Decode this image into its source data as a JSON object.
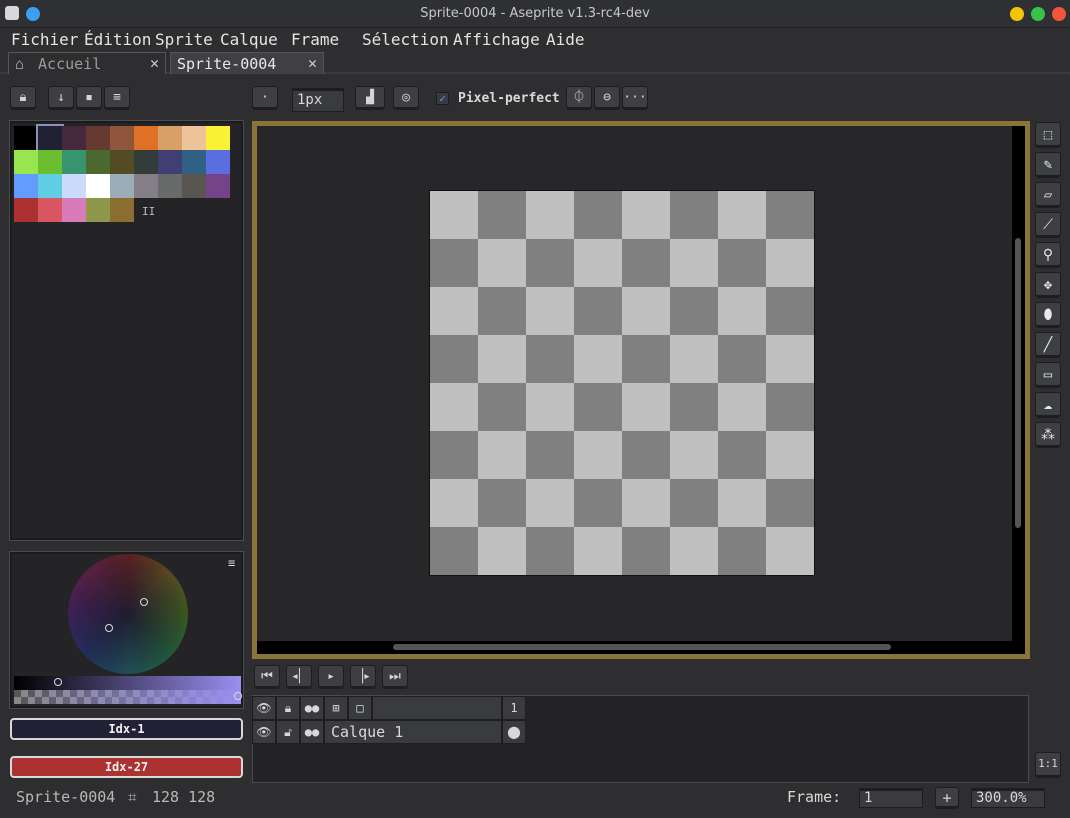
{
  "window": {
    "title": "Sprite-0004 - Aseprite v1.3-rc4-dev"
  },
  "menu": {
    "items": [
      "Fichier",
      "Édition",
      "Sprite",
      "Calque",
      "Frame",
      "Sélection",
      "Affichage",
      "Aide"
    ]
  },
  "tabs": [
    {
      "label": "Accueil"
    },
    {
      "label": "Sprite-0004"
    }
  ],
  "toolbar": {
    "brush_size": "1px",
    "pixel_perfect_label": "Pixel-perfect",
    "pixel_perfect_checked": true,
    "more": "···"
  },
  "palette": {
    "colors": [
      "#000000",
      "#222034",
      "#45283c",
      "#663931",
      "#8f563b",
      "#df7126",
      "#d9a066",
      "#eec39a",
      "#fbf236",
      "#99e550",
      "#6abe30",
      "#37946e",
      "#4b692f",
      "#524b24",
      "#323c39",
      "#3f3f74",
      "#306082",
      "#5b6ee1",
      "#639bff",
      "#5fcde4",
      "#cbdbfc",
      "#ffffff",
      "#9badb7",
      "#847e87",
      "#696a6a",
      "#595652",
      "#76428a",
      "#ac3232",
      "#d95763",
      "#d77bba",
      "#8f974a",
      "#8a6f30"
    ]
  },
  "color_bars": {
    "foreground": "Idx-1",
    "foreground_color": "#222034",
    "background": "Idx-27",
    "background_color": "#ac3232"
  },
  "timeline": {
    "frame_number": "1",
    "layer_name": "Calque 1"
  },
  "status": {
    "sprite_name": "Sprite-0004",
    "size": "128 128",
    "frame_label": "Frame:",
    "frame_value": "1",
    "add": "+",
    "zoom": "300.0%"
  },
  "tools": [
    "rectangular-marquee-icon",
    "pencil-icon",
    "eraser-icon",
    "eyedropper-icon",
    "zoom-icon",
    "move-icon",
    "paint-bucket-icon",
    "line-icon",
    "rectangle-icon",
    "blur-icon",
    "spray-icon"
  ],
  "zoom_button": "1:1"
}
